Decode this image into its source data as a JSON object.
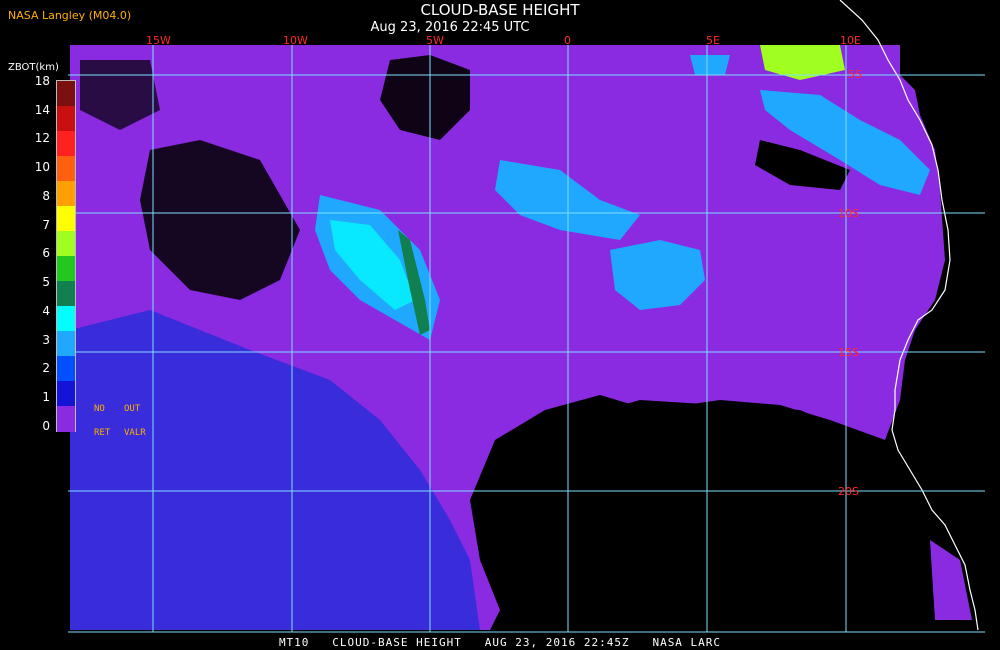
{
  "header": {
    "source": "NASA Langley (M04.0)",
    "title": "CLOUD-BASE HEIGHT",
    "timestamp": "Aug 23, 2016 22:45 UTC"
  },
  "footer": {
    "text": "MT10   CLOUD-BASE HEIGHT   AUG 23, 2016 22:45Z   NASA LARC"
  },
  "legend": {
    "title": "ZBOT(km)",
    "ticks": [
      "18",
      "14",
      "12",
      "10",
      "8",
      "7",
      "6",
      "5",
      "4",
      "3",
      "2",
      "1",
      "0"
    ],
    "colors": [
      "#7b1010",
      "#c81010",
      "#ff2020",
      "#ff6010",
      "#ffa000",
      "#ffff00",
      "#a0ff20",
      "#20c820",
      "#108050",
      "#00ffff",
      "#20a8ff",
      "#0050ff",
      "#1414d8",
      "#8a2be2"
    ],
    "no_ret_label_top": "NO",
    "no_ret_label_bottom": "RET",
    "out_valr_label_top": "OUT",
    "out_valr_label_bottom": "VALR"
  },
  "grid": {
    "longitude_labels": [
      "15W",
      "10W",
      "5W",
      "0",
      "5E",
      "10E"
    ],
    "latitude_labels": [
      "5S",
      "10S",
      "15S",
      "20S"
    ]
  },
  "colors": {
    "grid_line": "#7ee0ff",
    "grid_label": "#ff2a2a",
    "coastline": "#ffffff",
    "cloud_base_fill": "#8a2be2",
    "no_data": "#000000"
  }
}
